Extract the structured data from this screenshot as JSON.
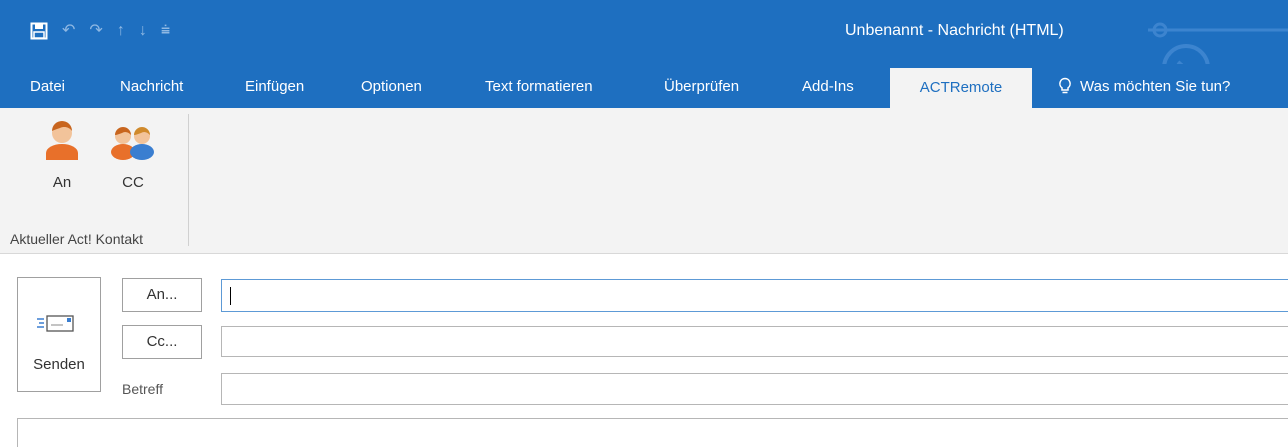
{
  "window": {
    "title": "Unbenannt  -  Nachricht (HTML)"
  },
  "quick_access": [
    {
      "name": "save-icon"
    },
    {
      "name": "undo-icon",
      "glyph": "↶"
    },
    {
      "name": "redo-icon",
      "glyph": "↷"
    },
    {
      "name": "previous-item-icon",
      "glyph": "↑"
    },
    {
      "name": "next-item-icon",
      "glyph": "↓"
    },
    {
      "name": "customize-qat-icon",
      "glyph": "⩧"
    }
  ],
  "tabs": [
    {
      "label": "Datei"
    },
    {
      "label": "Nachricht"
    },
    {
      "label": "Einfügen"
    },
    {
      "label": "Optionen"
    },
    {
      "label": "Text formatieren"
    },
    {
      "label": "Überprüfen"
    },
    {
      "label": "Add-Ins"
    },
    {
      "label": "ACTRemote",
      "active": true
    }
  ],
  "tell_me": {
    "label": "Was möchten Sie tun?"
  },
  "ribbon": {
    "group_label": "Aktueller Act! Kontakt",
    "buttons": [
      {
        "label": "An",
        "icon": "person-icon"
      },
      {
        "label": "CC",
        "icon": "people-icon"
      }
    ]
  },
  "compose": {
    "send_label": "Senden",
    "to_button": "An...",
    "cc_button": "Cc...",
    "subject_label": "Betreff",
    "to_value": "",
    "cc_value": "",
    "subject_value": ""
  },
  "colors": {
    "accent": "#1e6fc0",
    "ribbon_bg": "#f3f3f3",
    "person_orange": "#e8702a",
    "person_blue": "#3a7ed0"
  }
}
